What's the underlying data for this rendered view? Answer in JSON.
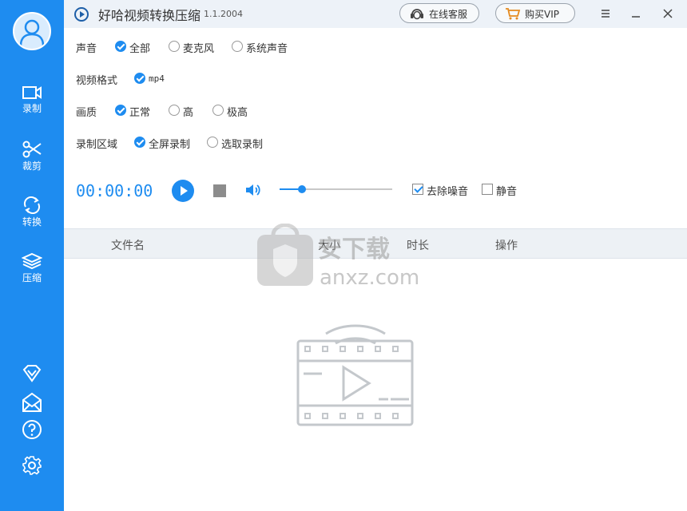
{
  "app": {
    "title": "好哈视频转换压缩",
    "version": "1.1.2004"
  },
  "header": {
    "service_label": "在线客服",
    "vip_label": "购买VIP"
  },
  "sidebar": {
    "items": [
      {
        "label": "录制",
        "icon": "record-icon"
      },
      {
        "label": "裁剪",
        "icon": "scissors-icon"
      },
      {
        "label": "转换",
        "icon": "convert-icon"
      },
      {
        "label": "压缩",
        "icon": "compress-icon"
      }
    ],
    "bottom_icons": [
      "vip-diamond-icon",
      "mail-icon",
      "help-icon",
      "settings-icon"
    ]
  },
  "settings": {
    "audio": {
      "label": "声音",
      "options": [
        {
          "label": "全部",
          "selected": true
        },
        {
          "label": "麦克风",
          "selected": false
        },
        {
          "label": "系统声音",
          "selected": false
        }
      ]
    },
    "format": {
      "label": "视频格式",
      "options": [
        {
          "label": "mp4",
          "selected": true
        }
      ]
    },
    "quality": {
      "label": "画质",
      "options": [
        {
          "label": "正常",
          "selected": true
        },
        {
          "label": "高",
          "selected": false
        },
        {
          "label": "极高",
          "selected": false
        }
      ]
    },
    "area": {
      "label": "录制区域",
      "options": [
        {
          "label": "全屏录制",
          "selected": true
        },
        {
          "label": "选取录制",
          "selected": false
        }
      ]
    }
  },
  "controls": {
    "timer": "00:00:00",
    "volume_level": 0.2,
    "denoise": {
      "label": "去除噪音",
      "checked": true
    },
    "mute": {
      "label": "静音",
      "checked": false
    }
  },
  "table": {
    "columns": [
      "文件名",
      "大小",
      "时长",
      "操作"
    ],
    "rows": []
  },
  "watermark": {
    "text": "安下载",
    "url": "anxz.com"
  },
  "colors": {
    "accent": "#1e8cf0",
    "titlebar": "#edf2f8",
    "table_header": "#edf1f5"
  }
}
